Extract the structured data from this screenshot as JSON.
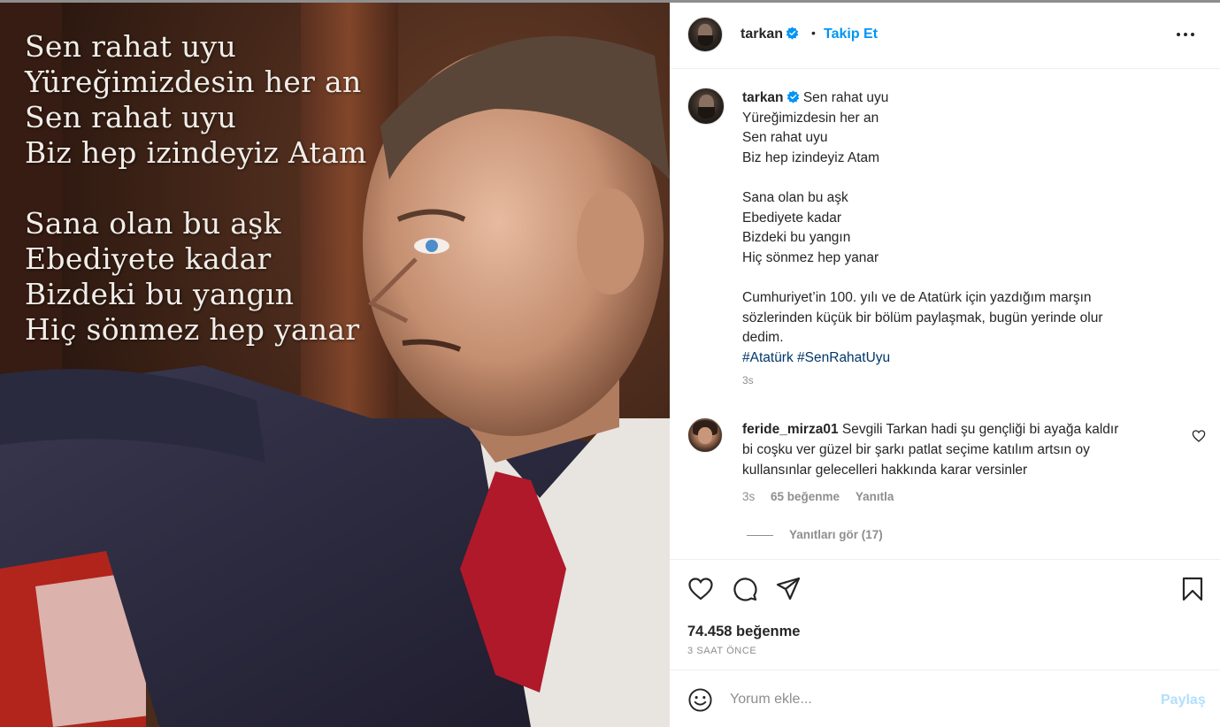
{
  "media": {
    "poem_stanzas": [
      [
        "Sen rahat uyu",
        "Yüreğimizdesin her an",
        "Sen rahat uyu",
        "Biz hep izindeyiz Atam"
      ],
      [
        "Sana olan bu aşk",
        "Ebediyete kadar",
        "Bizdeki bu yangın",
        "Hiç sönmez hep yanar"
      ]
    ]
  },
  "header": {
    "username": "tarkan",
    "dot": "•",
    "follow_label": "Takip Et",
    "verified_icon": "verified-badge-icon",
    "more_icon": "more-horizontal-icon"
  },
  "caption": {
    "username": "tarkan",
    "lines": [
      "Sen rahat uyu",
      "Yüreğimizdesin her an",
      "Sen rahat uyu",
      "Biz hep izindeyiz Atam",
      "",
      "Sana olan bu aşk",
      "Ebediyete kadar",
      "Bizdeki bu yangın",
      "Hiç sönmez hep yanar",
      "",
      "Cumhuriyet’in 100. yılı ve de Atatürk için yazdığım marşın",
      "sözlerinden küçük bir bölüm paylaşmak, bugün yerinde olur",
      "dedim."
    ],
    "hashtags": [
      "#Atatürk",
      "#SenRahatUyu"
    ],
    "time": "3s"
  },
  "comment": {
    "username": "feride_mirza01",
    "lines": [
      "Sevgili Tarkan hadi şu gençliği bi ayağa kaldır",
      "bi coşku ver güzel bir şarkı patlat seçime katılım artsın oy",
      "kullansınlar gelecelleri hakkında karar versinler"
    ],
    "time": "3s",
    "likes": "65 beğenme",
    "reply_label": "Yanıtla",
    "view_replies": "Yanıtları gör (17)"
  },
  "actions": {
    "likes": "74.458 beğenme",
    "when": "3 SAAT ÖNCE"
  },
  "composer": {
    "placeholder": "Yorum ekle...",
    "post_label": "Paylaş"
  },
  "colors": {
    "accent": "#0095f6",
    "hashtag": "#00376b",
    "muted": "#8e8e8e",
    "post_disabled": "#b2dffc"
  }
}
